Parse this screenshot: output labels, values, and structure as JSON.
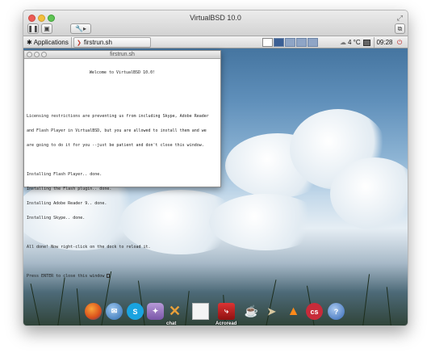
{
  "window": {
    "title": "VirtualBSD 10.0",
    "toolbar": {
      "pause_glyph": "❚❚",
      "screen_glyph": "▣",
      "tools_glyph": "🔧▸",
      "snapshot_glyph": "⧉"
    },
    "fullscreen_glyph": "⤢"
  },
  "panel": {
    "applications_label": "Applications",
    "task_label": "firstrun.sh",
    "weather": "4 °C",
    "clock": "09:28"
  },
  "terminal": {
    "title": "firstrun.sh",
    "lines": [
      "Welcome to VirtualBSD 10.0!",
      "",
      "",
      "Licensing restrictions are preventing us from including Skype, Adobe Reader",
      "and Flash Player in VirtualBSD, but you are allowed to install them and we",
      "are going to do it for you --just be patient and don't close this window.",
      "",
      "Installing Flash Player.. done.",
      "Installing the Flash plugin.. done.",
      "Installing Adobe Reader 9.. done.",
      "Installing Skype.. done.",
      "",
      "All done! Now right-click on the dock to reload it.",
      "",
      "Press ENTER to close this window "
    ]
  },
  "dock": {
    "chat_label": "chat",
    "acroread_label": "Acroread",
    "icons": [
      "firefox-icon",
      "thunderbird-icon",
      "skype-icon",
      "pidgin-icon",
      "xchat-icon",
      "document-icon",
      "acroread-icon",
      "coffee-icon",
      "fish-icon",
      "vlc-icon",
      "calibre-icon",
      "help-icon"
    ]
  },
  "colors": {
    "sky_top": "#3f6f9a",
    "accent_panel": "#3b5f95"
  }
}
